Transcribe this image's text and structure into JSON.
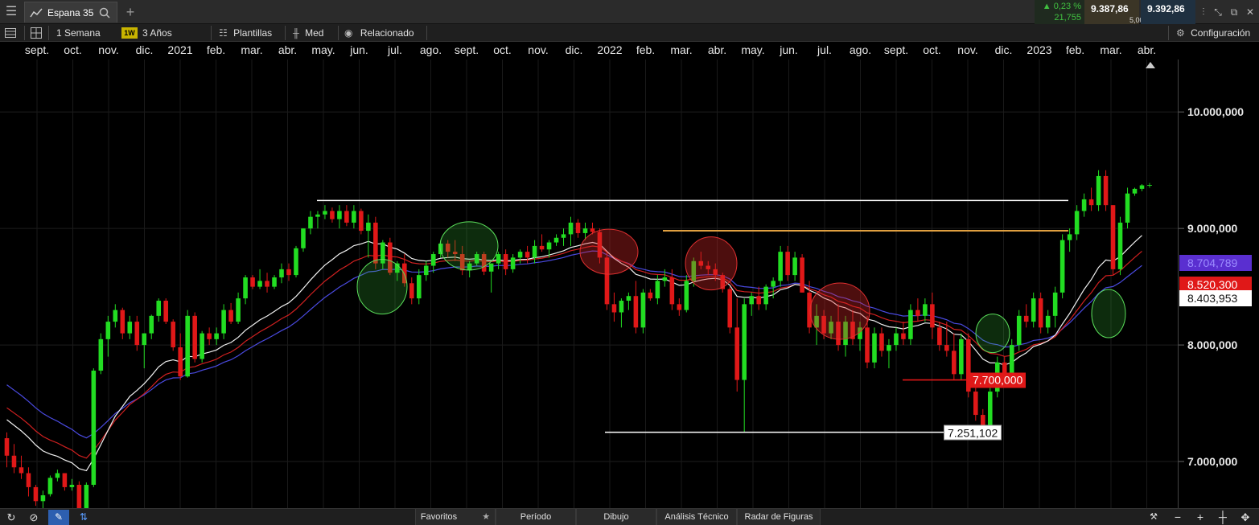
{
  "toolbar": {
    "tab_title": "Espana 35",
    "timeframe": "1 Semana",
    "tf_badge": "1W",
    "range": "3 Años",
    "templates": "Plantillas",
    "price_type": "Med",
    "related": "Relacionado",
    "config": "Configuración"
  },
  "quote": {
    "change_pct": "0,23 %",
    "change_pts": "21,755",
    "bid": "9.387,86",
    "spread": "5,00",
    "ask": "9.392,86"
  },
  "months": [
    "sept.",
    "oct.",
    "nov.",
    "dic.",
    "2021",
    "feb.",
    "mar.",
    "abr.",
    "may.",
    "jun.",
    "jul.",
    "ago.",
    "sept.",
    "oct.",
    "nov.",
    "dic.",
    "2022",
    "feb.",
    "mar.",
    "abr.",
    "may.",
    "jun.",
    "jul.",
    "ago.",
    "sept.",
    "oct.",
    "nov.",
    "dic.",
    "2023",
    "feb.",
    "mar.",
    "abr."
  ],
  "axis": {
    "labels": [
      "10.000,000",
      "9.000,000",
      "8.000,000",
      "7.000,000"
    ]
  },
  "price_tags": {
    "blue": "8.704,789",
    "red": "8.520,300",
    "white": "8.403,953"
  },
  "annotations": {
    "level_7700": "7.700,000",
    "level_7251": "7.251,102"
  },
  "bottom": {
    "favorites": "Favoritos",
    "period": "Período",
    "drawing": "Dibujo",
    "technical": "Análisis Técnico",
    "patterns": "Radar de Figuras"
  },
  "colors": {
    "up": "#22dd22",
    "down": "#e01818",
    "ma_blue": "#4a4ae0",
    "ma_red": "#d02020",
    "ma_white": "#f0f0f0",
    "orange_line": "#e0a040"
  },
  "chart_data": {
    "type": "candlestick",
    "instrument": "Espana 35",
    "timeframe": "1 Semana",
    "ylim": [
      6600,
      10450
    ],
    "y_ticks": [
      7000,
      8000,
      9000,
      10000
    ],
    "candles": [
      [
        7200,
        7250,
        6950,
        7050
      ],
      [
        7050,
        7150,
        6900,
        6950
      ],
      [
        6950,
        7050,
        6850,
        6900
      ],
      [
        6900,
        6950,
        6700,
        6780
      ],
      [
        6780,
        6800,
        6620,
        6660
      ],
      [
        6660,
        6750,
        6600,
        6710
      ],
      [
        6720,
        6880,
        6700,
        6860
      ],
      [
        6860,
        6930,
        6830,
        6900
      ],
      [
        6900,
        6900,
        6750,
        6780
      ],
      [
        6780,
        6850,
        6750,
        6800
      ],
      [
        6800,
        6830,
        6550,
        6560
      ],
      [
        6580,
        6820,
        6500,
        6800
      ],
      [
        6800,
        7800,
        6780,
        7780
      ],
      [
        7780,
        8100,
        7750,
        8050
      ],
      [
        8050,
        8250,
        7900,
        8200
      ],
      [
        8200,
        8350,
        8150,
        8300
      ],
      [
        8300,
        8320,
        8050,
        8100
      ],
      [
        8100,
        8250,
        8050,
        8200
      ],
      [
        8200,
        8250,
        7950,
        8000
      ],
      [
        8000,
        8100,
        7800,
        8100
      ],
      [
        8100,
        8260,
        8050,
        8250
      ],
      [
        8250,
        8400,
        8200,
        8380
      ],
      [
        8380,
        8400,
        8180,
        8200
      ],
      [
        8200,
        8220,
        7950,
        7980
      ],
      [
        7980,
        8100,
        7700,
        7730
      ],
      [
        7730,
        8300,
        7720,
        8250
      ],
      [
        8250,
        8280,
        7850,
        7880
      ],
      [
        7880,
        8120,
        7850,
        8100
      ],
      [
        8100,
        8150,
        8000,
        8050
      ],
      [
        8050,
        8150,
        8000,
        8100
      ],
      [
        8100,
        8350,
        8050,
        8300
      ],
      [
        8300,
        8360,
        8180,
        8200
      ],
      [
        8200,
        8450,
        8180,
        8400
      ],
      [
        8400,
        8600,
        8350,
        8580
      ],
      [
        8580,
        8600,
        8480,
        8500
      ],
      [
        8500,
        8650,
        8480,
        8550
      ],
      [
        8550,
        8620,
        8450,
        8500
      ],
      [
        8500,
        8600,
        8480,
        8580
      ],
      [
        8580,
        8700,
        8530,
        8650
      ],
      [
        8650,
        8700,
        8550,
        8600
      ],
      [
        8600,
        8850,
        8580,
        8830
      ],
      [
        8830,
        9000,
        8800,
        9000
      ],
      [
        9000,
        9150,
        8950,
        9100
      ],
      [
        9100,
        9150,
        9000,
        9120
      ],
      [
        9120,
        9200,
        9080,
        9150
      ],
      [
        9150,
        9180,
        9050,
        9080
      ],
      [
        9080,
        9200,
        9000,
        9150
      ],
      [
        9150,
        9200,
        9020,
        9050
      ],
      [
        9050,
        9200,
        9000,
        9150
      ],
      [
        9150,
        9170,
        8950,
        8980
      ],
      [
        8980,
        9120,
        8750,
        9050
      ],
      [
        9050,
        9100,
        8650,
        8700
      ],
      [
        8700,
        8900,
        8650,
        8880
      ],
      [
        8880,
        8920,
        8600,
        8620
      ],
      [
        8620,
        8720,
        8550,
        8700
      ],
      [
        8700,
        8780,
        8500,
        8530
      ],
      [
        8530,
        8580,
        8350,
        8400
      ],
      [
        8400,
        8650,
        8350,
        8600
      ],
      [
        8600,
        8720,
        8550,
        8680
      ],
      [
        8680,
        8800,
        8620,
        8780
      ],
      [
        8780,
        8900,
        8750,
        8870
      ],
      [
        8870,
        8900,
        8750,
        8800
      ],
      [
        8800,
        8900,
        8720,
        8780
      ],
      [
        8780,
        8850,
        8600,
        8640
      ],
      [
        8640,
        8720,
        8580,
        8700
      ],
      [
        8700,
        8800,
        8680,
        8780
      ],
      [
        8780,
        8800,
        8600,
        8630
      ],
      [
        8630,
        8700,
        8450,
        8700
      ],
      [
        8700,
        8800,
        8650,
        8780
      ],
      [
        8780,
        8820,
        8600,
        8650
      ],
      [
        8650,
        8780,
        8620,
        8750
      ],
      [
        8750,
        8820,
        8700,
        8800
      ],
      [
        8800,
        8850,
        8700,
        8750
      ],
      [
        8750,
        8900,
        8700,
        8850
      ],
      [
        8850,
        8950,
        8800,
        8820
      ],
      [
        8820,
        8900,
        8750,
        8880
      ],
      [
        8880,
        8950,
        8850,
        8920
      ],
      [
        8920,
        9000,
        8850,
        8950
      ],
      [
        8950,
        9100,
        8850,
        9050
      ],
      [
        9050,
        9080,
        8920,
        8960
      ],
      [
        8960,
        9050,
        8900,
        9000
      ],
      [
        9000,
        9050,
        8950,
        8970
      ],
      [
        8970,
        9000,
        8700,
        8750
      ],
      [
        8750,
        8800,
        8300,
        8350
      ],
      [
        8350,
        8450,
        8200,
        8280
      ],
      [
        8280,
        8400,
        8150,
        8380
      ],
      [
        8380,
        8450,
        8300,
        8420
      ],
      [
        8420,
        8550,
        8100,
        8150
      ],
      [
        8150,
        8480,
        8100,
        8450
      ],
      [
        8450,
        8480,
        8380,
        8400
      ],
      [
        8400,
        8600,
        8350,
        8550
      ],
      [
        8550,
        8650,
        8500,
        8580
      ],
      [
        8580,
        8650,
        8300,
        8350
      ],
      [
        8350,
        8400,
        8250,
        8300
      ],
      [
        8300,
        8600,
        8280,
        8550
      ],
      [
        8550,
        8750,
        8500,
        8720
      ],
      [
        8720,
        8800,
        8650,
        8680
      ],
      [
        8680,
        8720,
        8600,
        8650
      ],
      [
        8650,
        8700,
        8550,
        8600
      ],
      [
        8600,
        8620,
        8450,
        8480
      ],
      [
        8480,
        8500,
        8100,
        8150
      ],
      [
        8150,
        8400,
        7600,
        7700
      ],
      [
        7700,
        8400,
        7250,
        8350
      ],
      [
        8350,
        8450,
        8250,
        8420
      ],
      [
        8420,
        8500,
        8300,
        8350
      ],
      [
        8350,
        8520,
        8300,
        8500
      ],
      [
        8500,
        8580,
        8400,
        8550
      ],
      [
        8550,
        8850,
        8500,
        8800
      ],
      [
        8800,
        8850,
        8550,
        8600
      ],
      [
        8600,
        8800,
        8550,
        8750
      ],
      [
        8750,
        8780,
        8450,
        8450
      ],
      [
        8450,
        8550,
        8100,
        8150
      ],
      [
        8150,
        8350,
        8000,
        8250
      ],
      [
        8250,
        8300,
        8050,
        8100
      ],
      [
        8100,
        8250,
        8050,
        8200
      ],
      [
        8200,
        8350,
        7950,
        8000
      ],
      [
        8000,
        8250,
        7900,
        8200
      ],
      [
        8200,
        8300,
        8000,
        8050
      ],
      [
        8050,
        8200,
        7950,
        8150
      ],
      [
        8150,
        8250,
        7800,
        7850
      ],
      [
        7850,
        8150,
        7800,
        8100
      ],
      [
        8100,
        8150,
        7900,
        7950
      ],
      [
        7950,
        8050,
        7800,
        8000
      ],
      [
        8000,
        8150,
        7950,
        8100
      ],
      [
        8100,
        8200,
        8000,
        8050
      ],
      [
        8050,
        8350,
        8000,
        8300
      ],
      [
        8300,
        8400,
        8200,
        8250
      ],
      [
        8250,
        8400,
        8200,
        8350
      ],
      [
        8350,
        8450,
        8050,
        8150
      ],
      [
        8150,
        8200,
        7950,
        8000
      ],
      [
        8000,
        8200,
        7900,
        7950
      ],
      [
        7950,
        8100,
        7700,
        7750
      ],
      [
        7750,
        8100,
        7700,
        8050
      ],
      [
        8050,
        8100,
        7550,
        7600
      ],
      [
        7600,
        7650,
        7350,
        7400
      ],
      [
        7400,
        7450,
        7250,
        7300
      ],
      [
        7300,
        7650,
        7250,
        7600
      ],
      [
        7600,
        7900,
        7550,
        7850
      ],
      [
        7850,
        7900,
        7650,
        7700
      ],
      [
        7700,
        8050,
        7650,
        8000
      ],
      [
        8000,
        8300,
        7950,
        8250
      ],
      [
        8250,
        8350,
        8150,
        8200
      ],
      [
        8200,
        8450,
        8150,
        8400
      ],
      [
        8400,
        8450,
        8100,
        8150
      ],
      [
        8150,
        8300,
        8100,
        8250
      ],
      [
        8250,
        8500,
        8150,
        8450
      ],
      [
        8450,
        8950,
        8400,
        8900
      ],
      [
        8900,
        9000,
        8800,
        8950
      ],
      [
        8950,
        9200,
        8900,
        9150
      ],
      [
        9150,
        9300,
        9100,
        9250
      ],
      [
        9250,
        9350,
        9150,
        9200
      ],
      [
        9200,
        9500,
        9150,
        9450
      ],
      [
        9450,
        9500,
        9150,
        9200
      ],
      [
        9200,
        9200,
        8600,
        8650
      ],
      [
        8650,
        9100,
        8600,
        9050
      ],
      [
        9050,
        9350,
        9000,
        9300
      ],
      [
        9300,
        9350,
        9280,
        9340
      ],
      [
        9340,
        9380,
        9320,
        9370
      ]
    ],
    "moving_averages": [
      {
        "color": "blue",
        "last": 8704.789
      },
      {
        "color": "red",
        "last": 8520.3
      },
      {
        "color": "white",
        "last": 8403.953
      }
    ],
    "levels": [
      {
        "value": 9240,
        "color": "white"
      },
      {
        "value": 8980,
        "color": "orange"
      },
      {
        "value": 7700,
        "color": "red",
        "label": "7.700,000"
      },
      {
        "value": 7251.102,
        "color": "white",
        "label": "7.251,102"
      }
    ]
  }
}
